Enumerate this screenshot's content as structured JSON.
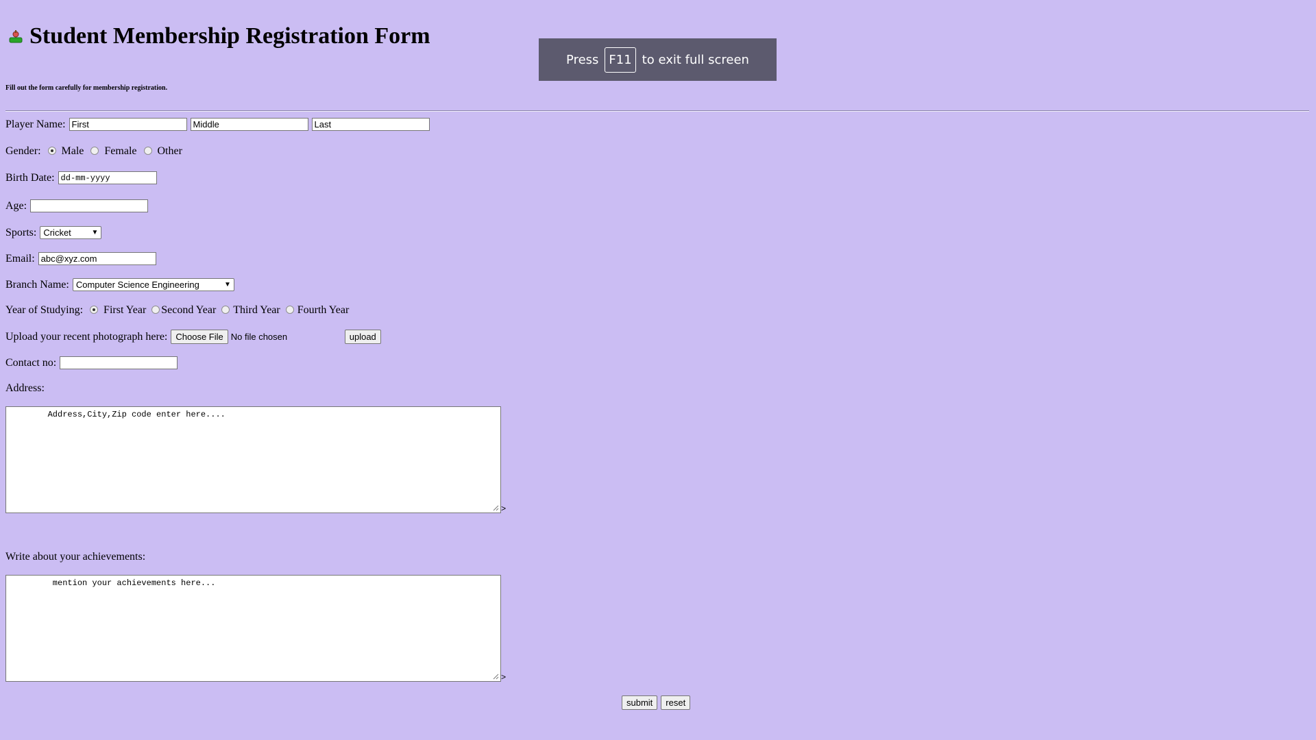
{
  "header": {
    "title": "Student Membership Registration Form",
    "logo_icon": "sport-logo-icon"
  },
  "subtitle": "Fill out the form carefully for membership registration.",
  "fullscreen_toast": {
    "press": "Press",
    "key": "F11",
    "suffix": "to exit full screen"
  },
  "form": {
    "player_name": {
      "label": "Player Name:",
      "first": "First",
      "middle": "Middle",
      "last": "Last"
    },
    "gender": {
      "label": "Gender:",
      "options": [
        "Male",
        "Female",
        "Other"
      ],
      "selected": "Male"
    },
    "birth_date": {
      "label": "Birth Date:",
      "placeholder": "dd-mm-yyyy"
    },
    "age": {
      "label": "Age:",
      "value": ""
    },
    "sports": {
      "label": "Sports:",
      "selected": "Cricket"
    },
    "email": {
      "label": "Email:",
      "value": "abc@xyz.com"
    },
    "branch": {
      "label": "Branch Name:",
      "selected": "Computer Science Engineering"
    },
    "year": {
      "label": "Year of Studying:",
      "options": [
        "First Year",
        "Second Year",
        "Third Year",
        "Fourth Year"
      ],
      "selected": "First Year"
    },
    "photo": {
      "label": "Upload your recent photograph here:",
      "choose_label": "Choose File",
      "status": "No file chosen",
      "upload_label": "upload"
    },
    "contact": {
      "label": "Contact no:",
      "value": ""
    },
    "address": {
      "label": "Address:",
      "text": "        Address,City,Zip code enter here....",
      "trailing": ">"
    },
    "achievements": {
      "label": "Write about your achievements:",
      "text": "         mention your achievements here...",
      "trailing": ">"
    },
    "submit_label": "submit",
    "reset_label": "reset"
  }
}
